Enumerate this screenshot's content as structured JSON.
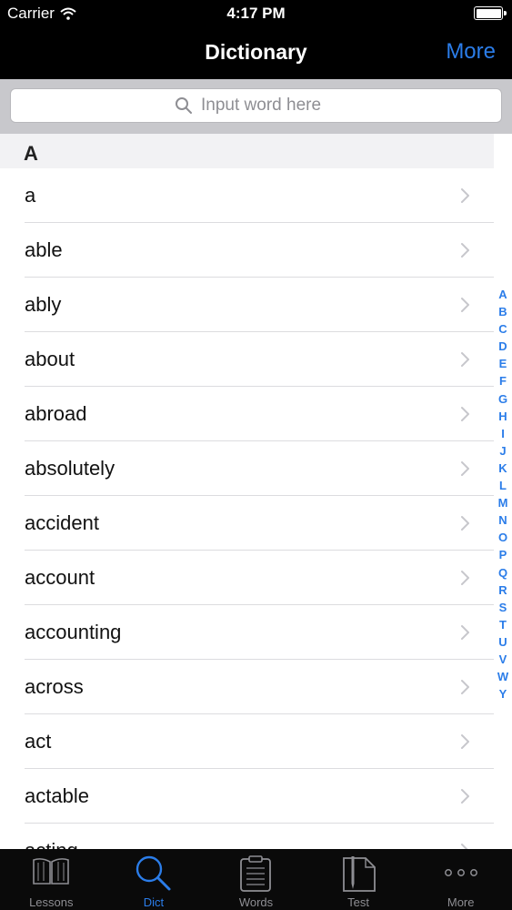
{
  "status_bar": {
    "carrier": "Carrier",
    "time": "4:17 PM",
    "battery_level": 1.0
  },
  "nav": {
    "title": "Dictionary",
    "right_button": "More"
  },
  "search": {
    "placeholder": "Input word here"
  },
  "section": {
    "header": "A"
  },
  "words": [
    "a",
    "able",
    "ably",
    "about",
    "abroad",
    "absolutely",
    "accident",
    "account",
    "accounting",
    "across",
    "act",
    "actable",
    "acting"
  ],
  "index_letters": [
    "A",
    "B",
    "C",
    "D",
    "E",
    "F",
    "G",
    "H",
    "I",
    "J",
    "K",
    "L",
    "M",
    "N",
    "O",
    "P",
    "Q",
    "R",
    "S",
    "T",
    "U",
    "V",
    "W",
    "Y"
  ],
  "tabs": [
    {
      "label": "Lessons",
      "icon": "book-icon",
      "active": false
    },
    {
      "label": "Dict",
      "icon": "magnifier-icon",
      "active": true
    },
    {
      "label": "Words",
      "icon": "clipboard-icon",
      "active": false
    },
    {
      "label": "Test",
      "icon": "pencil-paper-icon",
      "active": false
    },
    {
      "label": "More",
      "icon": "ellipsis-icon",
      "active": false
    }
  ],
  "colors": {
    "accent": "#2b7de9",
    "bar_background": "#000000",
    "search_background": "#c8c8cc"
  }
}
